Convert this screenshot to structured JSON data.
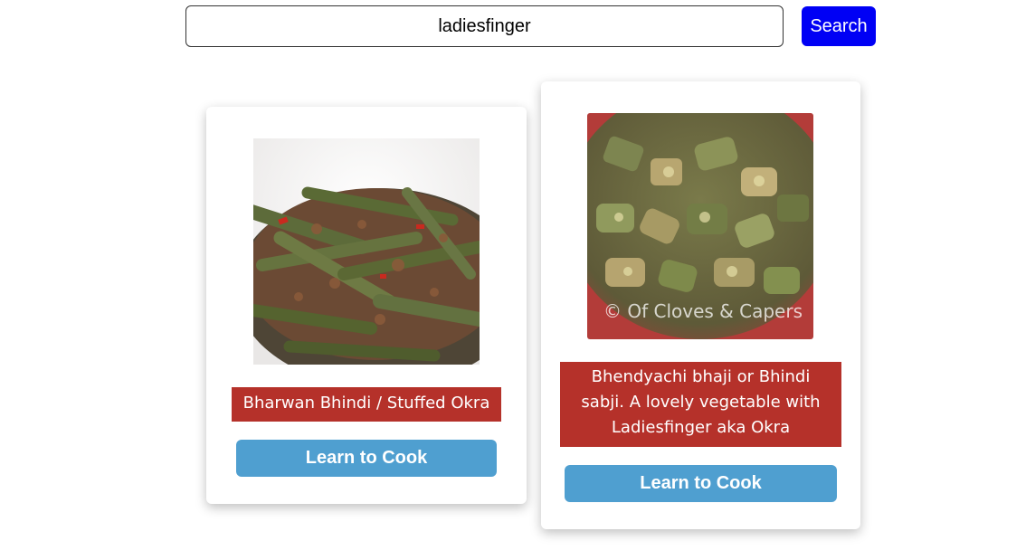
{
  "search": {
    "value": "ladiesfinger",
    "button_label": "Search"
  },
  "recipes": [
    {
      "title": "Bharwan Bhindi / Stuffed Okra",
      "button_label": "Learn to Cook"
    },
    {
      "title": "Bhendyachi bhaji or Bhindi sabji. A lovely vegetable with Ladiesfinger aka Okra",
      "button_label": "Learn to Cook",
      "image_watermark": "© Of Cloves & Capers"
    }
  ],
  "colors": {
    "search_button": "#0000f5",
    "title_background": "#b5312a",
    "cook_button": "#4f9fd0"
  }
}
